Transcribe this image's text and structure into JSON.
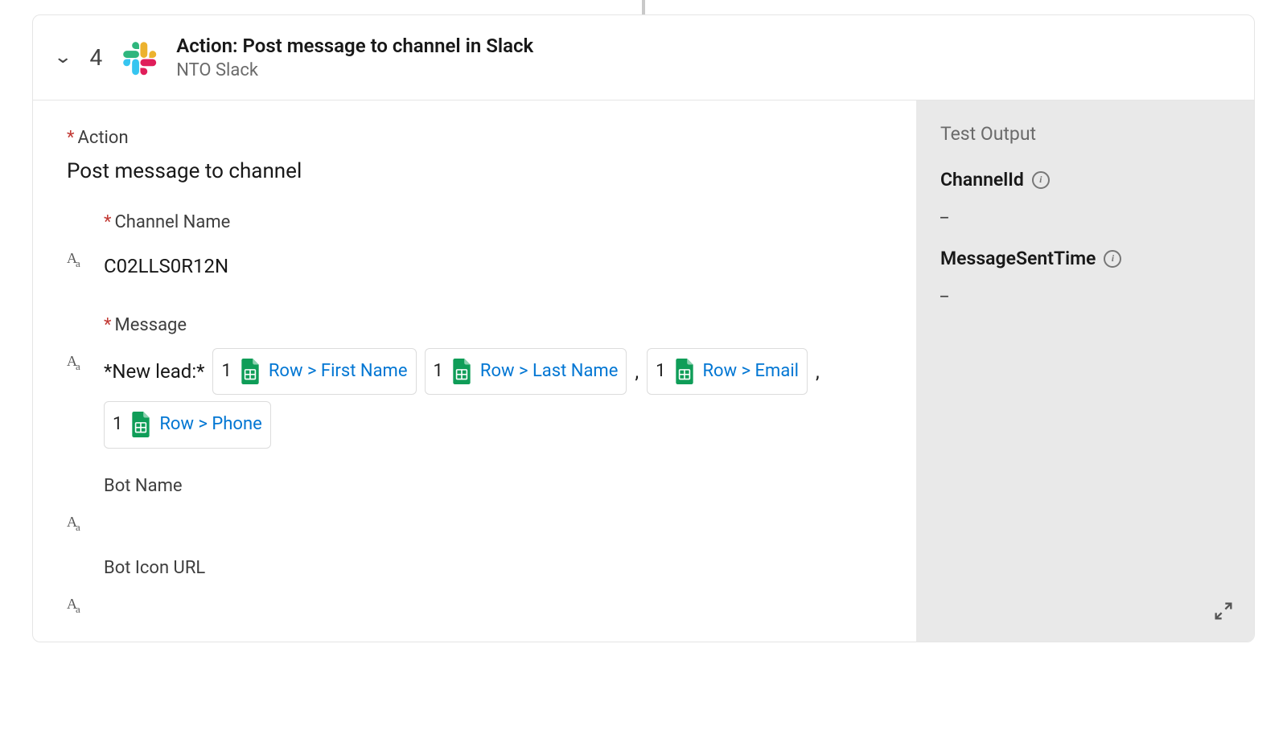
{
  "header": {
    "step_number": "4",
    "title": "Action: Post message to channel in Slack",
    "subtitle": "NTO Slack"
  },
  "main": {
    "action_label": "Action",
    "action_value": "Post message to channel",
    "channel_name_label": "Channel Name",
    "channel_name_value": "C02LLS0R12N",
    "message_label": "Message",
    "message_prefix": "*New lead:*",
    "tokens": [
      {
        "num": "1",
        "path": "Row > First Name"
      },
      {
        "num": "1",
        "path": "Row > Last Name"
      },
      {
        "num": "1",
        "path": "Row > Email"
      },
      {
        "num": "1",
        "path": "Row > Phone"
      }
    ],
    "separators": {
      "comma": ",",
      "space": " "
    },
    "bot_name_label": "Bot Name",
    "bot_name_value": "",
    "bot_icon_url_label": "Bot Icon URL",
    "bot_icon_url_value": ""
  },
  "side": {
    "title": "Test Output",
    "outputs": [
      {
        "label": "ChannelId",
        "value": "_"
      },
      {
        "label": "MessageSentTime",
        "value": "_"
      }
    ]
  }
}
